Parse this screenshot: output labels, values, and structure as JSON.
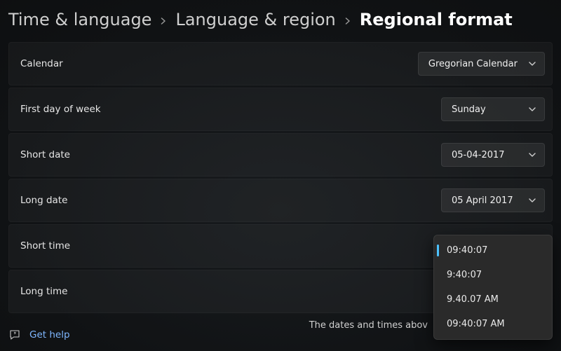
{
  "breadcrumb": {
    "items": [
      "Time & language",
      "Language & region",
      "Regional format"
    ],
    "active_index": 2
  },
  "rows": {
    "calendar": {
      "label": "Calendar",
      "value": "Gregorian Calendar"
    },
    "first_day": {
      "label": "First day of week",
      "value": "Sunday"
    },
    "short_date": {
      "label": "Short date",
      "value": "05-04-2017"
    },
    "long_date": {
      "label": "Long date",
      "value": "05 April 2017"
    },
    "short_time": {
      "label": "Short time",
      "value": ""
    },
    "long_time": {
      "label": "Long time",
      "value": ""
    }
  },
  "hint_text": "The dates and times abov",
  "help": {
    "label": "Get help"
  },
  "flyout": {
    "options": [
      "09:40:07",
      "9:40:07",
      "9.40.07 AM",
      "09:40:07 AM"
    ],
    "selected_index": 0
  }
}
